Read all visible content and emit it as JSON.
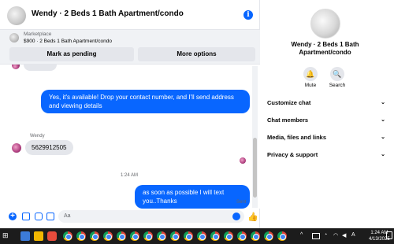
{
  "header": {
    "title": "Wendy · 2 Beds 1 Bath Apartment/condo"
  },
  "marketplace": {
    "label": "Marketplace",
    "listing": "$900 · 2 Beds 1 Bath Apartment/condo",
    "mark_pending": "Mark as pending",
    "more_options": "More options"
  },
  "messages": {
    "out1": "Yes, it's available! Drop your contact number, and I'll send address and viewing details",
    "sender": "Wendy",
    "in1": "5629912505",
    "timestamp": "1:24 AM",
    "out2": "as soon as possible I will text you..Thanks",
    "status": "Sent"
  },
  "composer": {
    "placeholder": "Aa"
  },
  "panel": {
    "title": "Wendy · 2 Beds 1 Bath Apartment/condo",
    "mute": "Mute",
    "search": "Search",
    "menu": [
      "Customize chat",
      "Chat members",
      "Media, files and links",
      "Privacy & support"
    ]
  },
  "taskbar": {
    "time": "1:24 AM",
    "date": "4/13/2025"
  },
  "colors": {
    "accent": "#0866ff",
    "bubble_in": "#e4e6eb",
    "taskbar": "#1c1c1c"
  }
}
